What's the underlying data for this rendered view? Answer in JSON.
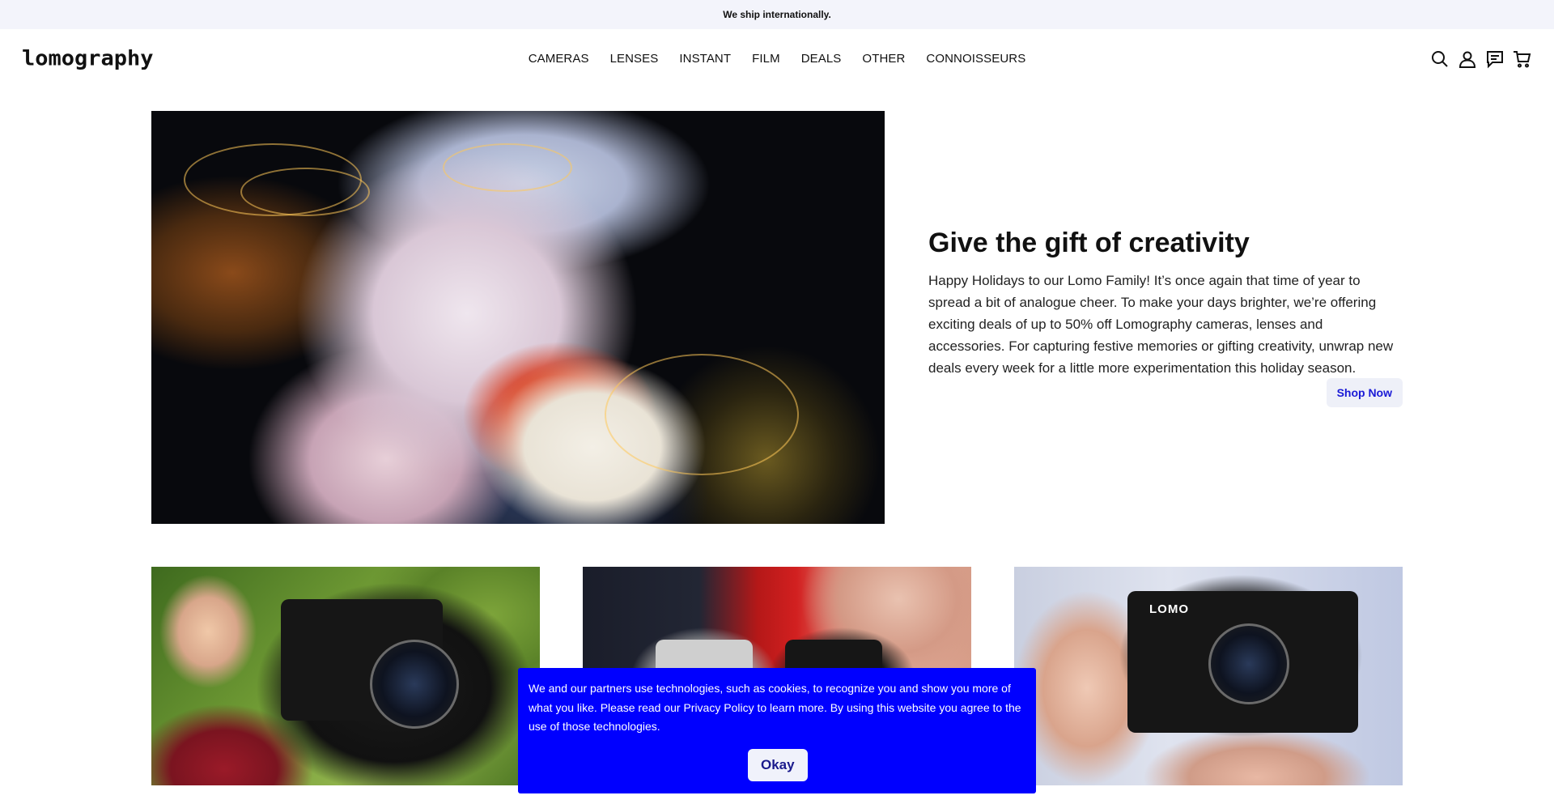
{
  "announcement": {
    "text": "We ship internationally."
  },
  "header": {
    "logo": "lomography",
    "nav": [
      "CAMERAS",
      "LENSES",
      "INSTANT",
      "FILM",
      "DEALS",
      "OTHER",
      "CONNOISSEURS"
    ],
    "icons": [
      "search-icon",
      "account-icon",
      "chat-icon",
      "cart-icon"
    ]
  },
  "hero": {
    "title": "Give the gift of creativity",
    "body": "Happy Holidays to our Lomo Family! It’s once again that time of year to spread a bit of analogue cheer. To make your days brighter, we’re offering exciting deals of up to 50% off Lomography cameras, lenses and accessories. For capturing festive memories or gifting creativity, unwrap new deals every week for a little more experimentation this holiday season.",
    "button_label": "Shop Now"
  },
  "tiles": {
    "tile3_brand": "LOMO"
  },
  "cookie": {
    "text": "We and our partners use technologies, such as cookies, to recognize you and show you more of what you like. Please read our Privacy Policy to learn more. By using this website you agree to the use of those technologies.",
    "button_label": "Okay"
  },
  "colors": {
    "cookie_bg": "#0000ff",
    "accent_link": "#1a1ad6",
    "announcement_bg": "#f3f4fb"
  }
}
